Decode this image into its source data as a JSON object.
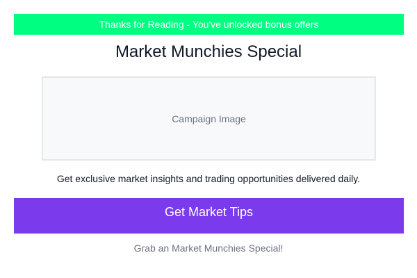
{
  "banner": {
    "text": "Thanks for Reading - You've unlocked bonus offers",
    "background_color": "#00ff80"
  },
  "header": {
    "title": "Market Munchies Special"
  },
  "campaign_image": {
    "placeholder_text": "Campaign Image"
  },
  "body": {
    "description": "Get exclusive market insights and trading opportunities delivered daily."
  },
  "cta": {
    "label": "Get Market Tips",
    "background_color": "#7c3aed"
  },
  "footer": {
    "text": "Grab an Market Munchies Special!"
  }
}
